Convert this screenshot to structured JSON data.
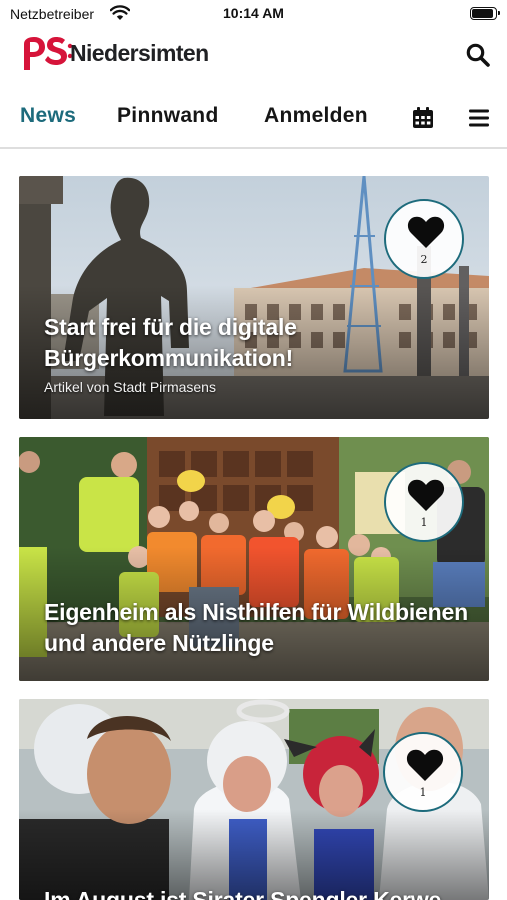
{
  "status_bar": {
    "carrier": "Netzbetreiber",
    "time": "10:14 AM"
  },
  "header": {
    "logo_text": "Niedersimten",
    "logo_color": "#d6143a"
  },
  "nav": {
    "tabs": [
      {
        "label": "News",
        "active": true
      },
      {
        "label": "Pinnwand",
        "active": false
      },
      {
        "label": "Anmelden",
        "active": false
      }
    ],
    "icons": [
      "calendar-icon",
      "menu-icon"
    ],
    "accent_color": "#1d6b7c"
  },
  "cards": [
    {
      "title": "Start frei für die digitale Bürgerkommunikation!",
      "source": "Artikel von Stadt Pirmasens",
      "likes": "2"
    },
    {
      "title": "Eigenheim als Nisthilfen für Wildbienen und andere Nützlinge",
      "likes": "1"
    },
    {
      "title": "Im August ist Sirater Spengler Kerwe",
      "likes": "1"
    }
  ]
}
